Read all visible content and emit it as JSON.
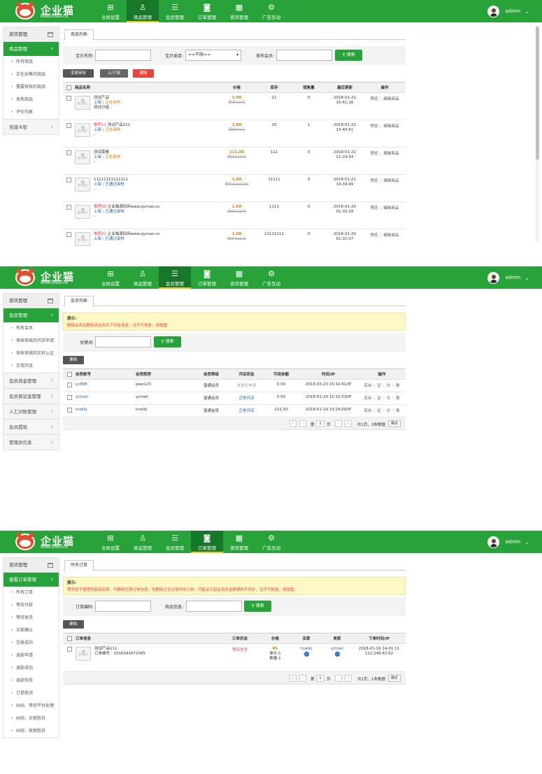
{
  "brand": {
    "name": "企业猫",
    "url": "WWW.QYMAO.CN"
  },
  "nav": [
    "全局设置",
    "商品管理",
    "会员管理",
    "订单管理",
    "资讯管理",
    "广告互动"
  ],
  "user": {
    "name": "admin"
  },
  "s1": {
    "side": {
      "head": "资讯管理",
      "active": "商品管理",
      "subs": [
        "所有商品",
        "正在出售的商品",
        "需要审核的商品",
        "发布商品",
        "评价列表"
      ],
      "groups": [
        "充值卡密"
      ]
    },
    "tab": "商品列表",
    "filter": {
      "name_label": "宝贝名称:",
      "cat_label": "宝贝类目:",
      "cat_value": "==不限==",
      "member_label": "发布会员:",
      "search": "搜索"
    },
    "buttons": {
      "audit": "变更审核",
      "shelf": "上/下架",
      "delete": "删除"
    },
    "cols": [
      "商品名称",
      "价格",
      "库存",
      "销售量",
      "最后更新",
      "操作"
    ],
    "thumb": "暂无图片",
    "rows": [
      {
        "pre": "",
        "title": "测试产品",
        "status_a": "上架",
        "status_b": "正在审核",
        "extra": "测试分组 -",
        "price": "1.00",
        "old": "原价11元",
        "stock": "11",
        "sold": "0",
        "date": "2018-01-22",
        "time": "15:41:16",
        "op1": "预览",
        "op2": "编辑商品"
      },
      {
        "pre": "推荐11",
        "title": "测试产品111",
        "status_a": "上架",
        "status_b": "正在审核",
        "extra": "-",
        "price": "1.00",
        "old": "原价11元",
        "stock": "10",
        "sold": "1",
        "date": "2018-01-22",
        "time": "15:40:51",
        "op1": "预览",
        "op2": "编辑商品"
      },
      {
        "pre": "",
        "title": "测试套餐",
        "status_a": "上架",
        "status_b": "正在审核",
        "extra": "-",
        "price": "111.00",
        "old": "原价111元",
        "stock": "111",
        "sold": "0",
        "date": "2018-01-21",
        "time": "21:24:34",
        "op1": "预览",
        "op2": "编辑商品"
      },
      {
        "pre": "",
        "title": "11111111111111",
        "status_a": "上架",
        "status_b": "已通过审核",
        "extra": "-",
        "price": "1.00",
        "old": "原价11111元",
        "stock": "11111",
        "sold": "0",
        "date": "2018-01-21",
        "time": "14:34:49",
        "op1": "预览",
        "op2": "编辑商品"
      },
      {
        "pre": "推荐88",
        "title": "企业猫源码网www.qymao.cn",
        "status_a": "上架",
        "status_b": "已通过审核",
        "extra": "-",
        "price": "1.00",
        "old": "原价111元",
        "stock": "1111",
        "sold": "0",
        "date": "2018-01-20",
        "time": "01:32:29",
        "op1": "预览",
        "op2": "编辑商品"
      },
      {
        "pre": "推荐22",
        "title": "企业猫源码网www.qymao.cn",
        "status_a": "上架",
        "status_b": "已通过审核",
        "extra": "",
        "price": "1.00",
        "old": "原价111元",
        "stock": "11111111",
        "sold": "0",
        "date": "2018-01-20",
        "time": "01:31:07",
        "op1": "预览",
        "op2": "编辑商品"
      }
    ]
  },
  "s2": {
    "side": {
      "head": "资讯管理",
      "active": "会员管理",
      "subs": [
        "所有会员",
        "审核审核的开店申请",
        "审核审核的实名认证",
        "正常开店"
      ],
      "groups": [
        "会员资金管理",
        "会员保证金管理",
        "人工对账管理",
        "会员提现",
        "管理员信息"
      ]
    },
    "tab": "会员列表",
    "notice": {
      "title": "提示:",
      "msg": "删除会员会删除该会员名下所有信息，且不可恢复，请慎重"
    },
    "filter": {
      "kw_label": "关键词:",
      "search": "搜索"
    },
    "buttons": {
      "delete": "删除"
    },
    "cols": [
      "会员帐号",
      "会员昵称",
      "会员等级",
      "开店状态",
      "可用余额",
      "时间/IP",
      "操作"
    ],
    "rows": [
      {
        "acct": "yc888",
        "nick": "qwe123",
        "level": "普通会员",
        "shop": "未提交申请",
        "bal": "0.50",
        "time": "2018-03-23 15:32:41/IP"
      },
      {
        "acct": "yctnwl",
        "nick": "yctnwl",
        "level": "普通会员",
        "shop": "正常开店",
        "bal": "0.50",
        "time": "2018-01-19 15:32:53/IP"
      },
      {
        "acct": "tnwlkj",
        "nick": "tnwlkj",
        "level": "普通会员",
        "shop": "正常开店",
        "bal": "221.50",
        "time": "2018-01-19 13:24:09/IP"
      }
    ],
    "ops": [
      "后台",
      "证",
      "分",
      "铁"
    ],
    "pager": {
      "pre": "第",
      "page": "1",
      "post": "页",
      "summary": "共1页，3条数据",
      "go": "确定"
    }
  },
  "s3": {
    "side": {
      "head": "资讯管理",
      "active": "查看订单管理",
      "subs": [
        "所有订单",
        "等待付款",
        "等待发货",
        "买家确认",
        "交易成功",
        "退款申请",
        "退款成功",
        "退款失败",
        "订单取消",
        "纠纷、等待平台处理",
        "纠纷、买家胜诉",
        "纠纷、卖家胜诉"
      ]
    },
    "tab": "所有订单",
    "notice": {
      "title": "提示:",
      "msg": "程序给予管理员最高权限，可删除任意订单信息，但删除正在交易中的订单，可能会引起会员资金数据的不同步，且不可恢复，请慎重。"
    },
    "filter": {
      "no_label": "订单编码:",
      "info_label": "商品信息:",
      "search": "搜索"
    },
    "buttons": {
      "delete": "删除"
    },
    "cols": [
      "订单信息",
      "订单状态",
      "价格",
      "买家",
      "卖家",
      "下单时间/IP"
    ],
    "row": {
      "title": "测试产品111",
      "order_no": "订单编号：1516341671065",
      "status": "等待发货",
      "price": "¥1",
      "unit": "单价:1",
      "qty": "数量:1",
      "buyer": "tnwlkj",
      "seller": "yctnwl",
      "time": "2018-01-19 14:01:11",
      "ip": "112.246.82.62"
    },
    "pager": {
      "pre": "第",
      "page": "1",
      "post": "页",
      "summary": "共1页，1条数据",
      "go": "确定"
    }
  }
}
